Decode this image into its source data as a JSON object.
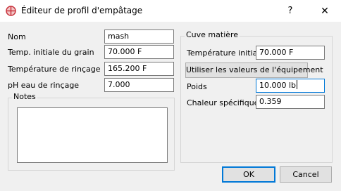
{
  "window": {
    "title": "Éditeur de profil d'empâtage",
    "help_label": "?",
    "close_label": "✕"
  },
  "form": {
    "name_label": "Nom",
    "name_value": "mash",
    "grain_temp_label": "Temp. initiale du grain",
    "grain_temp_value": "70.000 F",
    "sparge_temp_label": "Température de rinçage",
    "sparge_temp_value": "165.200 F",
    "sparge_ph_label": "pH eau de rinçage",
    "sparge_ph_value": "7.000",
    "notes_label": "Notes",
    "notes_value": ""
  },
  "tun": {
    "group_label": "Cuve matière",
    "init_temp_label": "Température initiale",
    "init_temp_value": "70.000 F",
    "use_equipment_button": "Utiliser les valeurs de l'équipement",
    "weight_label": "Poids",
    "weight_value": "10.000 lb",
    "specific_heat_label": "Chaleur spécifique",
    "specific_heat_value": "0.359"
  },
  "buttons": {
    "ok": "OK",
    "cancel": "Cancel"
  },
  "colors": {
    "focus_border": "#0078d7",
    "dialog_bg": "#f0f0f0",
    "icon_red": "#c8323c"
  },
  "icons": {
    "app": "brewtarget-crosshair-icon"
  }
}
